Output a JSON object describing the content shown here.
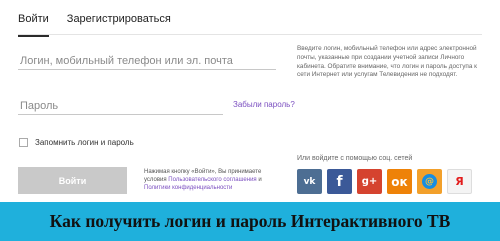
{
  "tabs": {
    "login": "Войти",
    "register": "Зарегистрироваться"
  },
  "form": {
    "login_placeholder": "Логин, мобильный телефон или эл. почта",
    "password_placeholder": "Пароль",
    "forgot_password": "Забыли пароль?",
    "remember_me": "Запомнить логин и пароль",
    "submit_label": "Войти"
  },
  "terms": {
    "prefix": "Нажимая кнопку «Войти», Вы принимаете условия ",
    "agreement_link": "Пользовательского соглашения",
    "middle": " и ",
    "privacy_link": "Политики конфиденциальности"
  },
  "hint": "Введите логин, мобильный телефон или адрес электронной почты, указанные при создании учетной записи Личного кабинета. Обратите внимание, что логин и пароль доступа к сети Интернет или услугам Телевидения не подходят.",
  "social": {
    "title": "Или войдите с помощью соц. сетей",
    "items": [
      {
        "name": "vk",
        "glyph": "vk"
      },
      {
        "name": "facebook",
        "glyph": "f"
      },
      {
        "name": "google-plus",
        "glyph": "g+"
      },
      {
        "name": "odnoklassniki",
        "glyph": "ок"
      },
      {
        "name": "mail-ru",
        "glyph": "@"
      },
      {
        "name": "yandex",
        "glyph": "Я"
      }
    ]
  },
  "banner": {
    "text": "Как получить логин и пароль Интерактивного ТВ"
  }
}
